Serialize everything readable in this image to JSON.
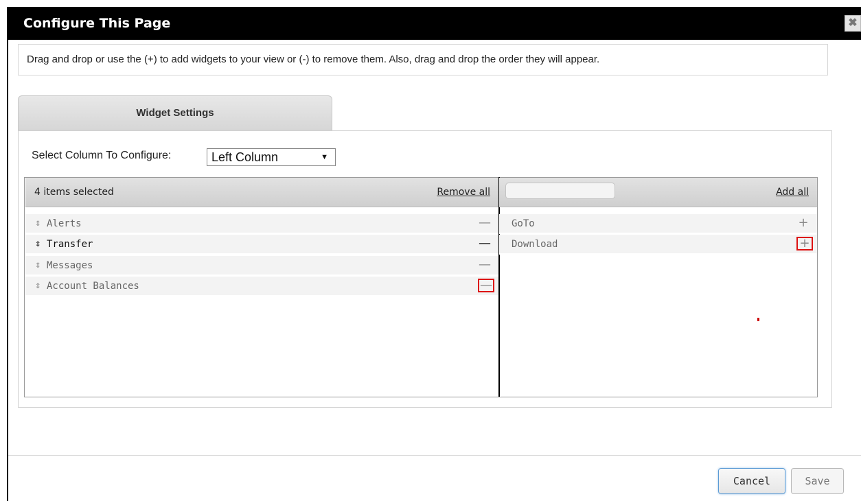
{
  "dialog": {
    "title": "Configure This Page",
    "close_label": "✖",
    "instruction": "Drag and drop or use the (+) to add widgets to your view or (-) to remove them. Also, drag and drop the order they will appear.",
    "tab_label": "Widget Settings",
    "select_label": "Select Column To Configure:",
    "select_value": "Left Column"
  },
  "selected_list": {
    "header": "4 items selected",
    "action_label": "Remove all",
    "items": [
      {
        "label": "Alerts",
        "action": "—"
      },
      {
        "label": "Transfer",
        "action": "—"
      },
      {
        "label": "Messages",
        "action": "—"
      },
      {
        "label": "Account Balances",
        "action": "—"
      }
    ]
  },
  "available_list": {
    "search_value": "",
    "action_label": "Add all",
    "items": [
      {
        "label": "GoTo",
        "action": "+"
      },
      {
        "label": "Download",
        "action": "+"
      }
    ]
  },
  "footer": {
    "cancel_label": "Cancel",
    "save_label": "Save"
  },
  "colors": {
    "titlebar": "#000000",
    "highlight": "#dd1111"
  }
}
